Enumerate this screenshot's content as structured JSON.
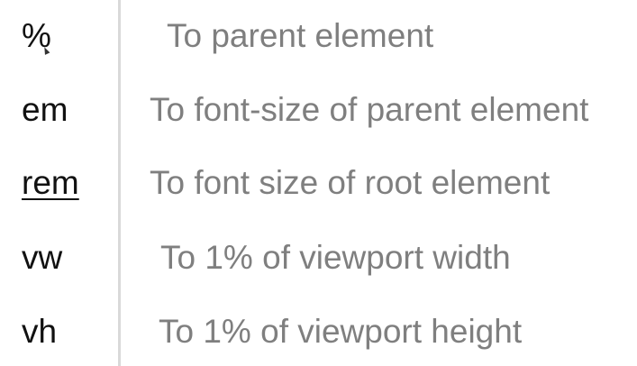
{
  "table": {
    "rows": [
      {
        "unit": "%",
        "description": "To parent element"
      },
      {
        "unit": "em",
        "description": "To font-size of parent element"
      },
      {
        "unit": "rem",
        "description": "To font size of root element"
      },
      {
        "unit": "vw",
        "description": "To 1% of viewport width"
      },
      {
        "unit": "vh",
        "description": "To 1% of viewport height"
      }
    ]
  },
  "colors": {
    "unit_text": "#111111",
    "description_text": "#7f7f7f",
    "divider": "#d9d9d9",
    "background": "#ffffff"
  },
  "icons": {
    "cursor": "mouse-pointer-icon"
  }
}
